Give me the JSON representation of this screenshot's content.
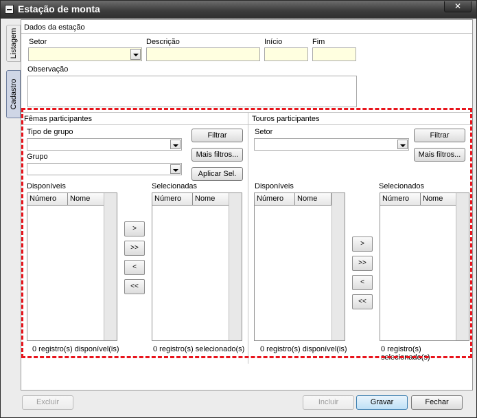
{
  "window": {
    "title": "Estação de monta",
    "close_label": "✕"
  },
  "side_tabs": [
    {
      "label": "Listagem"
    },
    {
      "label": "Cadastro"
    }
  ],
  "dados": {
    "section_title": "Dados da estação",
    "setor_label": "Setor",
    "setor_value": "",
    "descricao_label": "Descrição",
    "descricao_value": "",
    "inicio_label": "Início",
    "inicio_value": "",
    "fim_label": "Fim",
    "fim_value": "",
    "observacao_label": "Observação",
    "observacao_value": ""
  },
  "femeas": {
    "section_title": "Fêmas participantes",
    "tipo_grupo_label": "Tipo de grupo",
    "tipo_grupo_value": "",
    "grupo_label": "Grupo",
    "grupo_value": "",
    "filtrar_label": "Filtrar",
    "mais_filtros_label": "Mais filtros...",
    "aplicar_label": "Aplicar Sel.",
    "disponiveis_label": "Disponíveis",
    "selecionadas_label": "Selecionadas",
    "columns": [
      "Número",
      "Nome"
    ],
    "move_buttons": [
      ">",
      ">>",
      "<",
      "<<"
    ],
    "disponiveis_status": "0 registro(s) disponível(is)",
    "selecionadas_status": "0 registro(s) selecionado(s)"
  },
  "touros": {
    "section_title": "Touros participantes",
    "setor_label": "Setor",
    "setor_value": "",
    "filtrar_label": "Filtrar",
    "mais_filtros_label": "Mais filtros...",
    "disponiveis_label": "Disponíveis",
    "selecionados_label": "Selecionados",
    "columns": [
      "Número",
      "Nome"
    ],
    "move_buttons": [
      ">",
      ">>",
      "<",
      "<<"
    ],
    "disponiveis_status": "0 registro(s) disponível(is)",
    "selecionados_status": "0 registro(s) selecionado(s)"
  },
  "footer": {
    "excluir_label": "Excluir",
    "incluir_label": "Incluir",
    "gravar_label": "Gravar",
    "fechar_label": "Fechar"
  },
  "colors": {
    "highlight": "#e8141c",
    "required_field": "#ffffe0",
    "titlebar": "#3d3d3d"
  }
}
